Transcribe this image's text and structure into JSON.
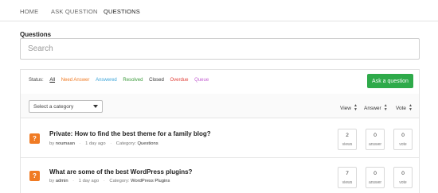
{
  "nav": {
    "items": [
      "HOME",
      "ASK QUESTION",
      "QUESTIONS"
    ],
    "active": "QUESTIONS"
  },
  "page": {
    "section_title": "Questions",
    "search_placeholder": "Search"
  },
  "status_filter": {
    "label": "Status:",
    "items": [
      {
        "label": "All",
        "color": "#222222"
      },
      {
        "label": "Need Answer",
        "color": "#f07b24"
      },
      {
        "label": "Answered",
        "color": "#3aa3d8"
      },
      {
        "label": "Resolved",
        "color": "#3a9a3a"
      },
      {
        "label": "Closed",
        "color": "#333333"
      },
      {
        "label": "Overdue",
        "color": "#e0403a"
      },
      {
        "label": "Queue",
        "color": "#c25cd0"
      }
    ]
  },
  "ask_button_label": "Ask a question",
  "category_select": {
    "value": "Select a category"
  },
  "sort_columns": [
    "View",
    "Answer",
    "Vote"
  ],
  "questions": [
    {
      "title": "Private: How to find the best theme for a family blog?",
      "by_prefix": "by",
      "author": "noumaan",
      "time": "1 day ago",
      "category_prefix": "Category:",
      "category": "Questions",
      "views": "2",
      "views_label": "views",
      "answers": "0",
      "answers_label": "answer",
      "votes": "0",
      "votes_label": "vote"
    },
    {
      "title": "What are some of the best WordPress plugins?",
      "by_prefix": "by",
      "author": "admin",
      "time": "1 day ago",
      "category_prefix": "Category:",
      "category": "WordPress Plugins",
      "views": "7",
      "views_label": "views",
      "answers": "0",
      "answers_label": "answer",
      "votes": "0",
      "votes_label": "vote"
    }
  ],
  "colors": {
    "accent_green": "#2eaa4a",
    "question_icon": "#f07b24"
  },
  "icons": {
    "question": "question-mark-icon"
  }
}
